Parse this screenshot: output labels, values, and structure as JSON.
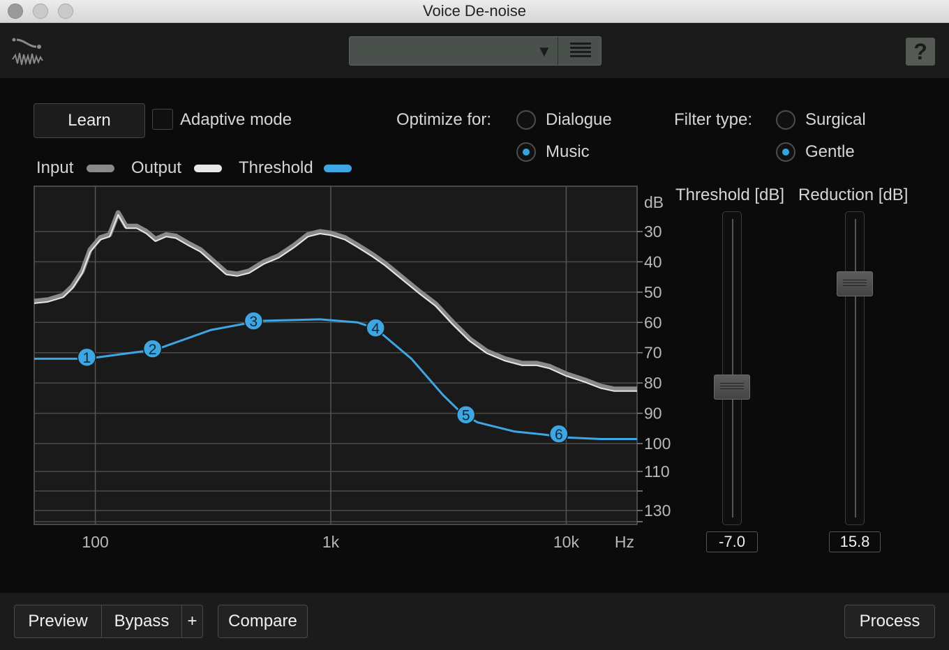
{
  "window": {
    "title": "Voice De-noise"
  },
  "header": {
    "logo_icon": "voice-denoise-logo-icon",
    "preset_icon": "preset-list-icon",
    "help_label": "?"
  },
  "controls": {
    "learn_label": "Learn",
    "adaptive_label": "Adaptive mode",
    "adaptive_checked": false,
    "optimize_label": "Optimize for:",
    "optimize_options": [
      "Dialogue",
      "Music"
    ],
    "optimize_selected": "Music",
    "filter_label": "Filter type:",
    "filter_options": [
      "Surgical",
      "Gentle"
    ],
    "filter_selected": "Gentle"
  },
  "legend": {
    "input": {
      "label": "Input",
      "color": "#8a8a8a"
    },
    "output": {
      "label": "Output",
      "color": "#e8e8e8"
    },
    "threshold": {
      "label": "Threshold",
      "color": "#3ea6e2"
    }
  },
  "faders": {
    "threshold": {
      "title": "Threshold [dB]",
      "value": "-7.0"
    },
    "reduction": {
      "title": "Reduction [dB]",
      "value": "15.8"
    }
  },
  "footer": {
    "preview_label": "Preview",
    "bypass_label": "Bypass",
    "plus_label": "+",
    "compare_label": "Compare",
    "process_label": "Process"
  },
  "chart_data": {
    "type": "line",
    "x_scale": "log",
    "xlim": [
      55,
      20000
    ],
    "ylim": [
      135,
      22
    ],
    "y_axis_inverted": true,
    "x_ticks": [
      {
        "value": 100,
        "label": "100"
      },
      {
        "value": 1000,
        "label": "1k"
      },
      {
        "value": 10000,
        "label": "10k"
      }
    ],
    "x_unit": "Hz",
    "y_unit": "dB",
    "y_ticks": [
      30,
      40,
      50,
      60,
      70,
      80,
      90,
      100,
      110,
      130
    ],
    "grid": true,
    "legend_position": "top-left",
    "series": [
      {
        "name": "Input",
        "color": "#8a8a8a",
        "points": [
          [
            55,
            53
          ],
          [
            63,
            52.5
          ],
          [
            73,
            51
          ],
          [
            80,
            48
          ],
          [
            88,
            43
          ],
          [
            95,
            36
          ],
          [
            105,
            32
          ],
          [
            115,
            31
          ],
          [
            125,
            26.5
          ],
          [
            135,
            29
          ],
          [
            150,
            29
          ],
          [
            165,
            30
          ],
          [
            180,
            32.5
          ],
          [
            200,
            31
          ],
          [
            220,
            31.5
          ],
          [
            250,
            34
          ],
          [
            280,
            36
          ],
          [
            320,
            40
          ],
          [
            360,
            43.5
          ],
          [
            400,
            44
          ],
          [
            450,
            43
          ],
          [
            520,
            40
          ],
          [
            600,
            38
          ],
          [
            700,
            34.5
          ],
          [
            800,
            31
          ],
          [
            900,
            30
          ],
          [
            1000,
            30.5
          ],
          [
            1150,
            32
          ],
          [
            1300,
            34.5
          ],
          [
            1500,
            37.5
          ],
          [
            1700,
            40.5
          ],
          [
            2000,
            45
          ],
          [
            2400,
            50
          ],
          [
            2800,
            54
          ],
          [
            3300,
            60
          ],
          [
            3900,
            65.5
          ],
          [
            4600,
            69.5
          ],
          [
            5500,
            72
          ],
          [
            6500,
            73.5
          ],
          [
            7500,
            73.5
          ],
          [
            8500,
            74.5
          ],
          [
            10000,
            77
          ],
          [
            12000,
            79
          ],
          [
            14000,
            81
          ],
          [
            16000,
            82
          ],
          [
            20000,
            82
          ]
        ]
      },
      {
        "name": "Output",
        "color": "#e8e8e8",
        "points": [
          [
            55,
            53
          ],
          [
            63,
            52.5
          ],
          [
            73,
            51
          ],
          [
            80,
            48
          ],
          [
            88,
            43
          ],
          [
            95,
            36
          ],
          [
            105,
            32
          ],
          [
            115,
            31
          ],
          [
            125,
            26.5
          ],
          [
            135,
            29
          ],
          [
            150,
            29
          ],
          [
            165,
            30
          ],
          [
            180,
            32.5
          ],
          [
            200,
            31
          ],
          [
            220,
            31.5
          ],
          [
            250,
            34
          ],
          [
            280,
            36
          ],
          [
            320,
            40
          ],
          [
            360,
            43.5
          ],
          [
            400,
            44
          ],
          [
            450,
            43
          ],
          [
            520,
            40
          ],
          [
            600,
            38
          ],
          [
            700,
            34.5
          ],
          [
            800,
            31
          ],
          [
            900,
            30
          ],
          [
            1000,
            30.5
          ],
          [
            1150,
            32
          ],
          [
            1300,
            34.5
          ],
          [
            1500,
            37.5
          ],
          [
            1700,
            40.5
          ],
          [
            2000,
            45
          ],
          [
            2400,
            50
          ],
          [
            2800,
            54
          ],
          [
            3300,
            60
          ],
          [
            3900,
            65.5
          ],
          [
            4600,
            69.5
          ],
          [
            5500,
            72
          ],
          [
            6500,
            73.5
          ],
          [
            7500,
            73.5
          ],
          [
            8500,
            74.5
          ],
          [
            10000,
            77
          ],
          [
            12000,
            79
          ],
          [
            14000,
            81
          ],
          [
            16000,
            82
          ],
          [
            20000,
            82
          ]
        ]
      },
      {
        "name": "Threshold",
        "color": "#3ea6e2",
        "points": [
          [
            55,
            72
          ],
          [
            92,
            72
          ],
          [
            180,
            69
          ],
          [
            310,
            62.5
          ],
          [
            500,
            59.5
          ],
          [
            900,
            59
          ],
          [
            1300,
            60
          ],
          [
            1550,
            62
          ],
          [
            2200,
            72
          ],
          [
            3000,
            84
          ],
          [
            3600,
            90
          ],
          [
            4200,
            93
          ],
          [
            6000,
            96
          ],
          [
            8000,
            97
          ],
          [
            10000,
            98
          ],
          [
            14000,
            98.5
          ],
          [
            20000,
            98.5
          ]
        ],
        "nodes": [
          {
            "label": "1",
            "x": 92,
            "y": 71.5
          },
          {
            "label": "2",
            "x": 175,
            "y": 68.7
          },
          {
            "label": "3",
            "x": 470,
            "y": 59.5
          },
          {
            "label": "4",
            "x": 1550,
            "y": 61.8
          },
          {
            "label": "5",
            "x": 3750,
            "y": 90.5
          },
          {
            "label": "6",
            "x": 9300,
            "y": 96.8
          }
        ]
      }
    ]
  }
}
